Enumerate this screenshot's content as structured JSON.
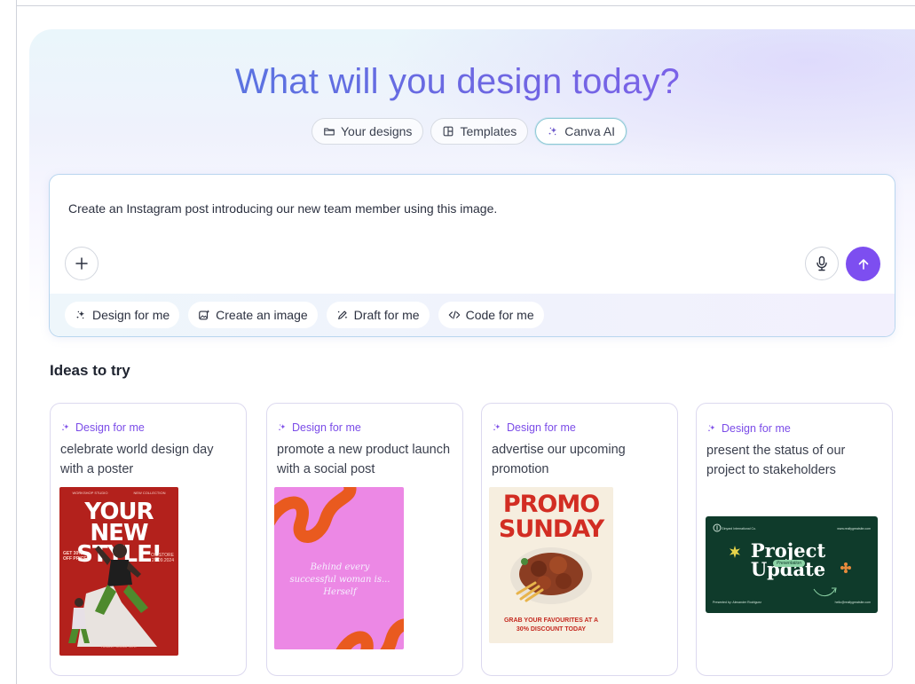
{
  "hero": {
    "title": "What will you design today?",
    "tabs": [
      {
        "label": "Your designs",
        "icon": "folder-icon"
      },
      {
        "label": "Templates",
        "icon": "template-icon"
      },
      {
        "label": "Canva AI",
        "icon": "sparkle-icon",
        "active": true
      }
    ]
  },
  "prompt": {
    "text": "Create an Instagram post introducing our new team member using this image.",
    "add_icon": "plus-icon",
    "mic_icon": "microphone-icon",
    "send_icon": "arrow-up-icon",
    "chips": [
      {
        "label": "Design for me",
        "icon": "sparkle-icon"
      },
      {
        "label": "Create an image",
        "icon": "image-sparkle-icon"
      },
      {
        "label": "Draft for me",
        "icon": "pen-sparkle-icon"
      },
      {
        "label": "Code for me",
        "icon": "code-icon"
      }
    ]
  },
  "ideas": {
    "title": "Ideas to try",
    "cards": [
      {
        "label": "Design for me",
        "text": "celebrate world design day with a poster",
        "thumb": {
          "headline": "YOUR NEW STYLE!",
          "top_left": "WORKSHOP STUDIO",
          "top_right": "NEW COLLECTION",
          "left_text": "GET 30% OFF PRICE!",
          "right_text": "ON STORE 27.09.2024",
          "footer": "REALLY GREAT SITE"
        }
      },
      {
        "label": "Design for me",
        "text": "promote a new product launch with a social post",
        "thumb": {
          "quote": "Behind every successful woman is... Herself"
        }
      },
      {
        "label": "Design for me",
        "text": "advertise our upcoming promotion",
        "thumb": {
          "headline": "PROMO SUNDAY",
          "footer": "GRAB YOUR FAVOURITES AT A 30% DISCOUNT TODAY"
        }
      },
      {
        "label": "Design for me",
        "text": "present the status of our project to stakeholders",
        "thumb": {
          "headline": "Project Update",
          "badge": "Presentation",
          "brand": "Ginyard International Co.",
          "site": "www.reallygreatsite.com",
          "presenter": "Presented by: Alexander Rodriguez",
          "email": "hello@reallygreatsite.com"
        }
      }
    ]
  },
  "colors": {
    "accent": "#7d4ef0",
    "title_gradient_start": "#4a7fe0",
    "title_gradient_end": "#8b5cf0"
  }
}
